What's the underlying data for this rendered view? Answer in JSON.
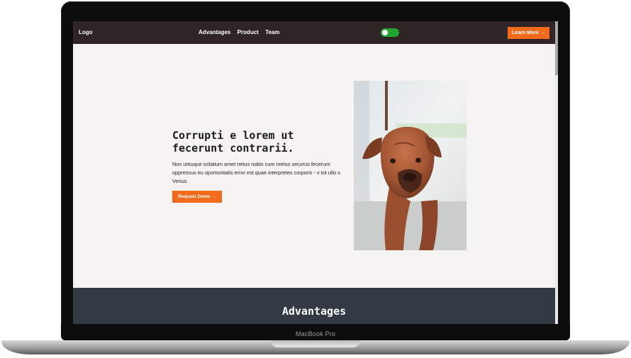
{
  "device": {
    "label": "MacBook Pro"
  },
  "nav": {
    "logo": "Logo",
    "links": [
      "Advantages",
      "Product",
      "Team"
    ],
    "theme_toggle": {
      "state": "on",
      "color": "#23a531"
    },
    "cta": "Learn More →"
  },
  "hero": {
    "title": "Corrupti e lorem ut fecerunt contrarii.",
    "body": "Non utriuque solatium amet netus nobis cum metus securus fecerunt oppressus eu oportunitatis error est quae interpretes corporis - v tot ullo s Verius.",
    "button": "Request Demo →",
    "image": "brown-dog-photo"
  },
  "section": {
    "title": "Advantages"
  },
  "colors": {
    "nav_bg": "#2f2526",
    "accent": "#f26b1d",
    "page_bg": "#f6f3f3",
    "section_bg": "#323a44"
  }
}
